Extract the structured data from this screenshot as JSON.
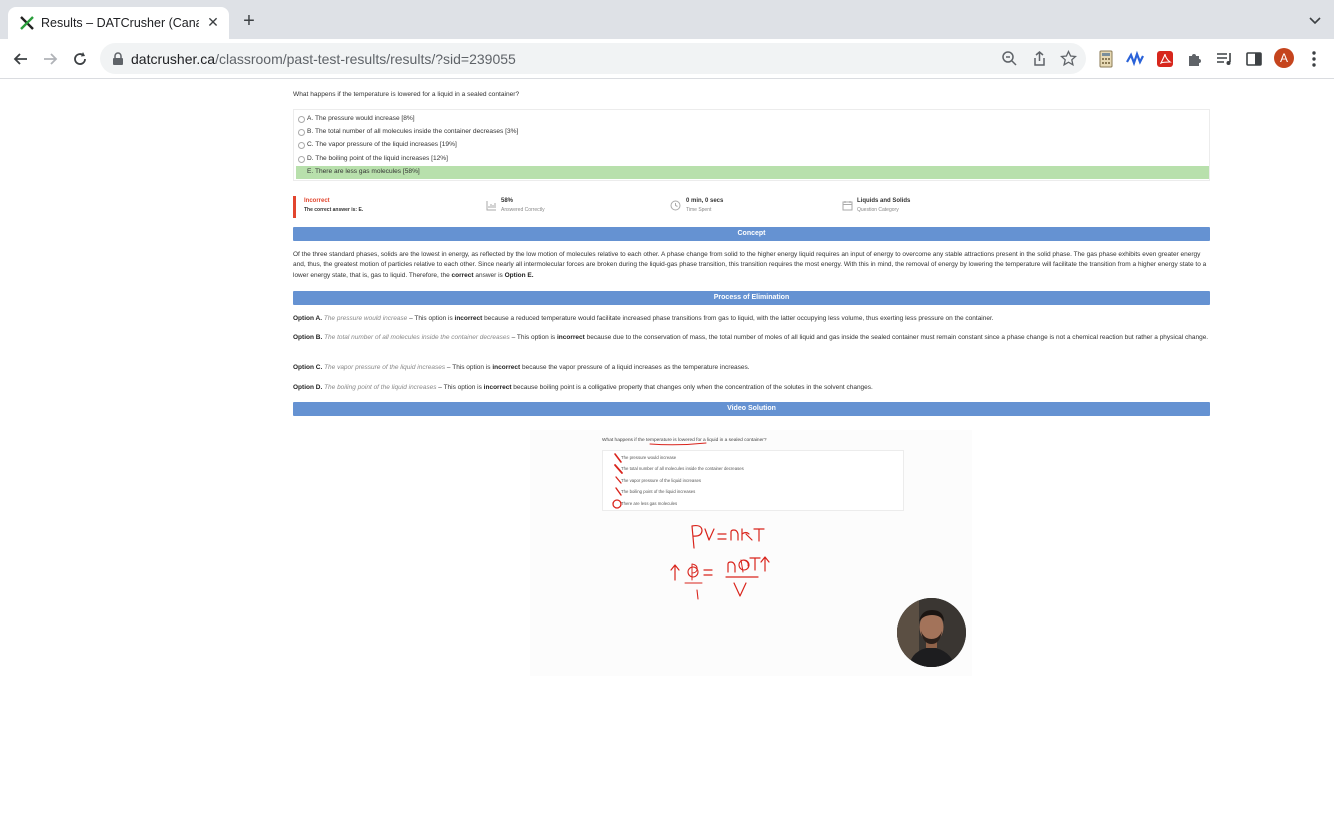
{
  "browser": {
    "tab_title": "Results – DATCrusher (Canadian",
    "url_host": "datcrusher.ca",
    "url_path": "/classroom/past-test-results/results/?sid=239055",
    "profile_initial": "A"
  },
  "question": {
    "text": "What happens if the temperature is lowered for a liquid in a sealed container?",
    "options": [
      {
        "label": "A. The pressure would increase [8%]"
      },
      {
        "label": "B. The total number of all molecules inside the container decreases [3%]"
      },
      {
        "label": "C. The vapor pressure of the liquid increases [19%]"
      },
      {
        "label": "D. The boiling point of the liquid increases [12%]"
      },
      {
        "label": "E. There are less gas molecules [58%]"
      }
    ]
  },
  "stats": {
    "result": "Incorrect",
    "correct_answer": "The correct answer is: E.",
    "percent": "58%",
    "percent_label": "Answered Correctly",
    "time": "0 min, 0 secs",
    "time_label": "Time Spent",
    "category": "Liquids and Solids",
    "category_label": "Question Category"
  },
  "concept": {
    "header": "Concept",
    "p1": "Of the three standard phases, solids are the lowest in energy, as reflected by the low motion of molecules relative to each other. A phase change from solid to the higher energy liquid requires an input of energy to overcome any stable attractions present in the solid phase. The gas phase exhibits even greater energy and, thus, the greatest motion of particles relative to each other. Since nearly all intermolecular forces are broken during the liquid-gas phase transition, this transition requires the most energy. With this in mind, the removal of energy by lowering the temperature will facilitate the transition from a higher energy state to a lower energy state, that is, gas to liquid. Therefore, the ",
    "p1_bold": "correct",
    "p1_mid": " answer is ",
    "p1_answer": "Option E."
  },
  "elimination": {
    "header": "Process of Elimination",
    "items": [
      {
        "opt": "Option A.",
        "quote": "The pressure would increase",
        "pre": " – This option is ",
        "verdict": "incorrect",
        "post": " because a reduced temperature would facilitate increased phase transitions from gas to liquid, with the latter occupying less volume, thus exerting less pressure on the container."
      },
      {
        "opt": "Option B.",
        "quote": "The total number of all molecules inside the container decreases",
        "pre": " – This option is ",
        "verdict": "incorrect",
        "post": " because due to the conservation of mass, the total number of moles of all liquid and gas inside the sealed container must remain constant since a phase change is not a chemical reaction but rather a physical change."
      },
      {
        "opt": "Option C.",
        "quote": "The vapor pressure of the liquid increases",
        "pre": " – This option is ",
        "verdict": "incorrect",
        "post": " because the vapor pressure of a liquid increases as the temperature increases."
      },
      {
        "opt": "Option D.",
        "quote": "The boiling point of the liquid increases",
        "pre": " – This option is ",
        "verdict": "incorrect",
        "post": " because boiling point is a colligative property that changes only when the concentration of the solutes in the solvent changes."
      }
    ]
  },
  "video": {
    "header": "Video Solution",
    "question": "What happens if the temperature is lowered for a liquid in a sealed container?",
    "options": [
      "The pressure would increase",
      "The total number of all molecules inside the container decreases",
      "The vapor pressure of the liquid increases",
      "The boiling point of the liquid increases",
      "There are less gas molecules"
    ]
  },
  "colors": {
    "accent_bar": "#6592d2",
    "correct_highlight": "#b8e0ac",
    "incorrect_red": "#e2452e",
    "ink_red": "#d9241c"
  }
}
